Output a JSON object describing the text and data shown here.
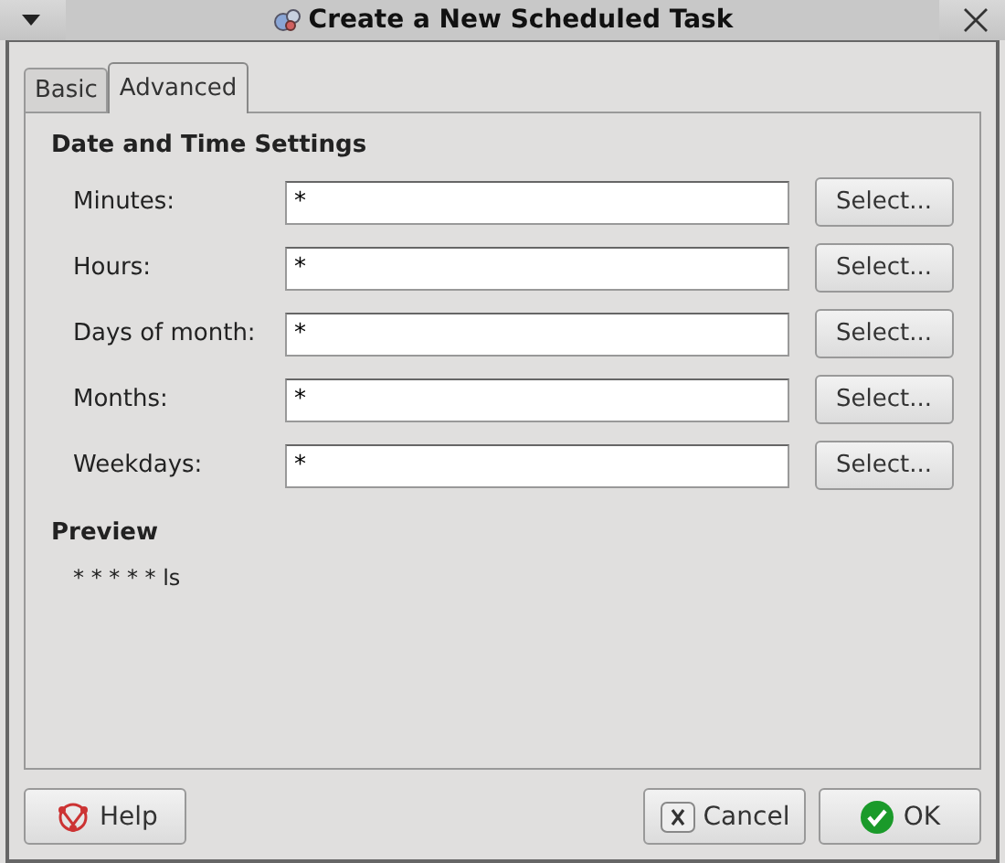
{
  "window": {
    "title": "Create a New Scheduled Task"
  },
  "tabs": [
    {
      "label": "Basic",
      "selected": false
    },
    {
      "label": "Advanced",
      "selected": true
    }
  ],
  "section_title": "Date and Time Settings",
  "fields": [
    {
      "label": "Minutes:",
      "value": "*",
      "button": "Select..."
    },
    {
      "label": "Hours:",
      "value": "*",
      "button": "Select..."
    },
    {
      "label": "Days of month:",
      "value": "*",
      "button": "Select..."
    },
    {
      "label": "Months:",
      "value": "*",
      "button": "Select..."
    },
    {
      "label": "Weekdays:",
      "value": "*",
      "button": "Select..."
    }
  ],
  "preview": {
    "title": "Preview",
    "text": "* * * * * ls"
  },
  "buttons": [
    {
      "kind": "help",
      "label": "Help"
    },
    {
      "kind": "cancel",
      "label": "Cancel"
    },
    {
      "kind": "ok",
      "label": "OK"
    }
  ]
}
